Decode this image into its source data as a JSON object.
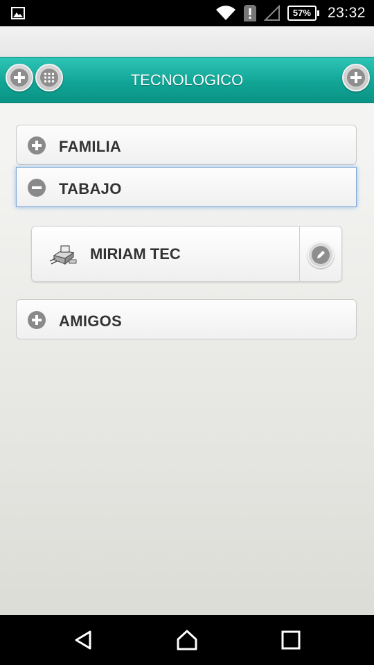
{
  "status_bar": {
    "battery": "57%",
    "time": "23:32",
    "icons": [
      "gallery-icon",
      "wifi-icon",
      "alert-icon",
      "no-signal-icon",
      "battery-icon"
    ]
  },
  "header": {
    "title": "TECNOLOGICO",
    "left_buttons": [
      "add-icon",
      "grid-icon"
    ],
    "right_button": "add-icon"
  },
  "groups": [
    {
      "label": "FAMILIA",
      "icon": "plus-circle-icon",
      "expanded": false
    },
    {
      "label": "TABAJO",
      "icon": "minus-circle-icon",
      "expanded": true
    },
    {
      "label": "AMIGOS",
      "icon": "plus-circle-icon",
      "expanded": false
    }
  ],
  "contact": {
    "name": "MIRIAM TEC",
    "icon": "device-icon",
    "action_icon": "pencil-icon"
  },
  "nav_bar": {
    "icons": [
      "back-icon",
      "home-icon",
      "recents-icon"
    ]
  },
  "colors": {
    "header_teal": "#11a596",
    "active_border": "#7ea8d8",
    "icon_gray": "#8a8a8a"
  }
}
